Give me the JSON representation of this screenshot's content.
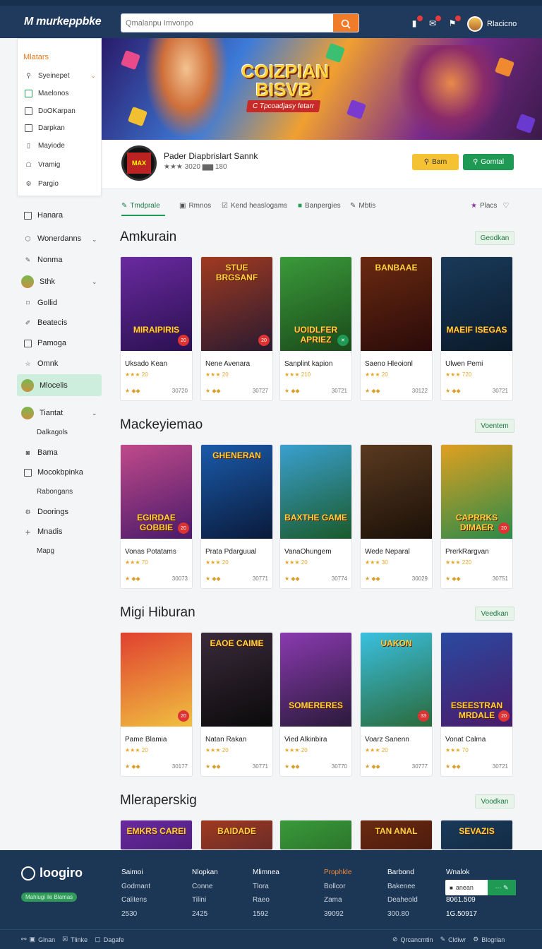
{
  "header": {
    "logo": "M murkeppbke",
    "search_placeholder": "Qmalanpu Imvonpo",
    "username": "Rlacicno"
  },
  "hero": {
    "title": "COIZPIAN BISVB",
    "subtitle": "C Tpcoadjasy fetarr"
  },
  "profile": {
    "name": "Pader Diapbrislart Sannk",
    "rating": "★★★ 3020 ▆▆ 180",
    "avatar_text": "MAX",
    "btn_primary": "Barn",
    "btn_secondary": "Gorntal"
  },
  "side_card": {
    "header": "Mlatars",
    "items": [
      {
        "label": "Syeinepet",
        "icon": "search-icon"
      },
      {
        "label": "Maelonos",
        "icon": "square-icon"
      },
      {
        "label": "DoOKarpan",
        "icon": "box-icon"
      },
      {
        "label": "Darpkan",
        "icon": "box-icon"
      },
      {
        "label": "Mayiode",
        "icon": "phone-icon"
      },
      {
        "label": "Vramig",
        "icon": "chat-icon"
      },
      {
        "label": "Pargio",
        "icon": "gear-icon"
      }
    ]
  },
  "side_nav": {
    "items": [
      {
        "label": "Hanara"
      },
      {
        "label": "Wonerdanns"
      },
      {
        "label": "Nonma"
      },
      {
        "label": "Sthk"
      },
      {
        "label": "Gollid"
      },
      {
        "label": "Beatecis"
      },
      {
        "label": "Pamoga"
      },
      {
        "label": "Omnk"
      },
      {
        "label": "Mlocelis"
      },
      {
        "label": "Tiantat"
      },
      {
        "label": "Dalkagols"
      },
      {
        "label": "Bama"
      },
      {
        "label": "Mocokbpinka"
      },
      {
        "label": "Rabongans"
      },
      {
        "label": "Doorings"
      },
      {
        "label": "Mnadis"
      },
      {
        "label": "Mapg"
      }
    ]
  },
  "tabs": [
    {
      "label": "Tmdprale"
    },
    {
      "label": "Rmnos"
    },
    {
      "label": "Kend heaslogams"
    },
    {
      "label": "Banpergies"
    },
    {
      "label": "Mbtis"
    }
  ],
  "tabs_right": "Placs",
  "sections": [
    {
      "title": "Amkurain",
      "button": "Geodkan",
      "cards": [
        {
          "name": "Uksado Kean",
          "rating": "★★★ 20",
          "meta_l": "★ ◆◆",
          "meta_r": "30720",
          "art": "MIRAIPIRIS",
          "badge": "20"
        },
        {
          "name": "Nene Avenara",
          "rating": "★★★ 20",
          "meta_l": "★ ◆◆",
          "meta_r": "30727",
          "art": "STUE BRGSANF",
          "badge": "20"
        },
        {
          "name": "Sanplint kapion",
          "rating": "★★★ 210",
          "meta_l": "★ ◆◆",
          "meta_r": "30721",
          "art": "UOIDLFER APRIEZ",
          "badge": "✕"
        },
        {
          "name": "Saeno Hleoionl",
          "rating": "★★★ 20",
          "meta_l": "★ ◆◆",
          "meta_r": "30122",
          "art": "BANBAAE",
          "badge": ""
        },
        {
          "name": "Ulwen Pemi",
          "rating": "★★★ 720",
          "meta_l": "★ ◆◆",
          "meta_r": "30721",
          "art": "MAEIF ISEGAS",
          "badge": ""
        }
      ]
    },
    {
      "title": "Mackeyiemao",
      "button": "Voentem",
      "cards": [
        {
          "name": "Vonas Potatams",
          "rating": "★★★ 70",
          "meta_l": "★ ◆◆",
          "meta_r": "30073",
          "art": "EGIRDAE GOBBIE",
          "badge": "20"
        },
        {
          "name": "Prata Pdarguual",
          "rating": "★★★ 20",
          "meta_l": "★ ◆◆",
          "meta_r": "30771",
          "art": "GHENERAN",
          "badge": ""
        },
        {
          "name": "VanaOhungem",
          "rating": "★★★ 20",
          "meta_l": "★ ◆◆",
          "meta_r": "30774",
          "art": "BAXTHE GAME",
          "badge": ""
        },
        {
          "name": "Wede Neparal",
          "rating": "★★★ 30",
          "meta_l": "★ ◆◆",
          "meta_r": "30029",
          "art": "",
          "badge": ""
        },
        {
          "name": "PrerkRargvan",
          "rating": "★★★ 220",
          "meta_l": "★ ◆◆",
          "meta_r": "30751",
          "art": "CAPRRKS DIMAER",
          "badge": "20"
        }
      ]
    },
    {
      "title": "Migi Hiburan",
      "button": "Veedkan",
      "cards": [
        {
          "name": "Pame Blamia",
          "rating": "★★★ 20",
          "meta_l": "★ ◆◆",
          "meta_r": "30177",
          "art": "",
          "badge": "20"
        },
        {
          "name": "Natan Rakan",
          "rating": "★★★ 20",
          "meta_l": "★ ◆◆",
          "meta_r": "30771",
          "art": "EAOE CAIME",
          "badge": ""
        },
        {
          "name": "Vied Alkinbira",
          "rating": "★★★ 20",
          "meta_l": "★ ◆◆",
          "meta_r": "30770",
          "art": "SOMERERES",
          "badge": ""
        },
        {
          "name": "Voarz Sanenn",
          "rating": "★★★ 20",
          "meta_l": "★ ◆◆",
          "meta_r": "30777",
          "art": "UAKON",
          "badge": "33"
        },
        {
          "name": "Vonat Calma",
          "rating": "★★★ 70",
          "meta_l": "★ ◆◆",
          "meta_r": "30721",
          "art": "ESEESTRAN MRDALE",
          "badge": "20"
        }
      ]
    },
    {
      "title": "Mleraperskig",
      "button": "Voodkan",
      "cards": [
        {
          "art": "EMKRS CAREI"
        },
        {
          "art": "BAIDADE"
        },
        {
          "art": ""
        },
        {
          "art": "TAN ANAL"
        },
        {
          "art": "SEVAZIS"
        }
      ]
    }
  ],
  "footer": {
    "logo": "loogiro",
    "tag": "Mahlugi ile Blamas",
    "cols": [
      {
        "items": [
          "Saimoi",
          "Godmant",
          "Calitens",
          "2530"
        ]
      },
      {
        "items": [
          "Nlopkan",
          "Conne",
          "Tilini",
          "2425"
        ]
      },
      {
        "items": [
          "Mlimnea",
          "Tlora",
          "Raeo",
          "1592"
        ]
      },
      {
        "items": [
          "Prophkle",
          "Bollcor",
          "Zama",
          "39092"
        ]
      },
      {
        "items": [
          "Barbond",
          "Bakenee",
          "Deaheold",
          "300.80"
        ]
      },
      {
        "items": [
          "Wnalok",
          "",
          "8061.509",
          "1G.50917"
        ]
      }
    ],
    "subscribe_label": "anean",
    "subscribe_btn": "",
    "bottom_left": [
      "Glnan",
      "Tlinke",
      "Dagafe"
    ],
    "bottom_right": [
      "Qrcancmtin",
      "Cldiwr",
      "Blogrian"
    ]
  },
  "colors": {
    "topbar": "#1f3a5c",
    "accent_orange": "#f07c2a",
    "accent_green": "#1e9a55",
    "footer": "#1c3655"
  }
}
